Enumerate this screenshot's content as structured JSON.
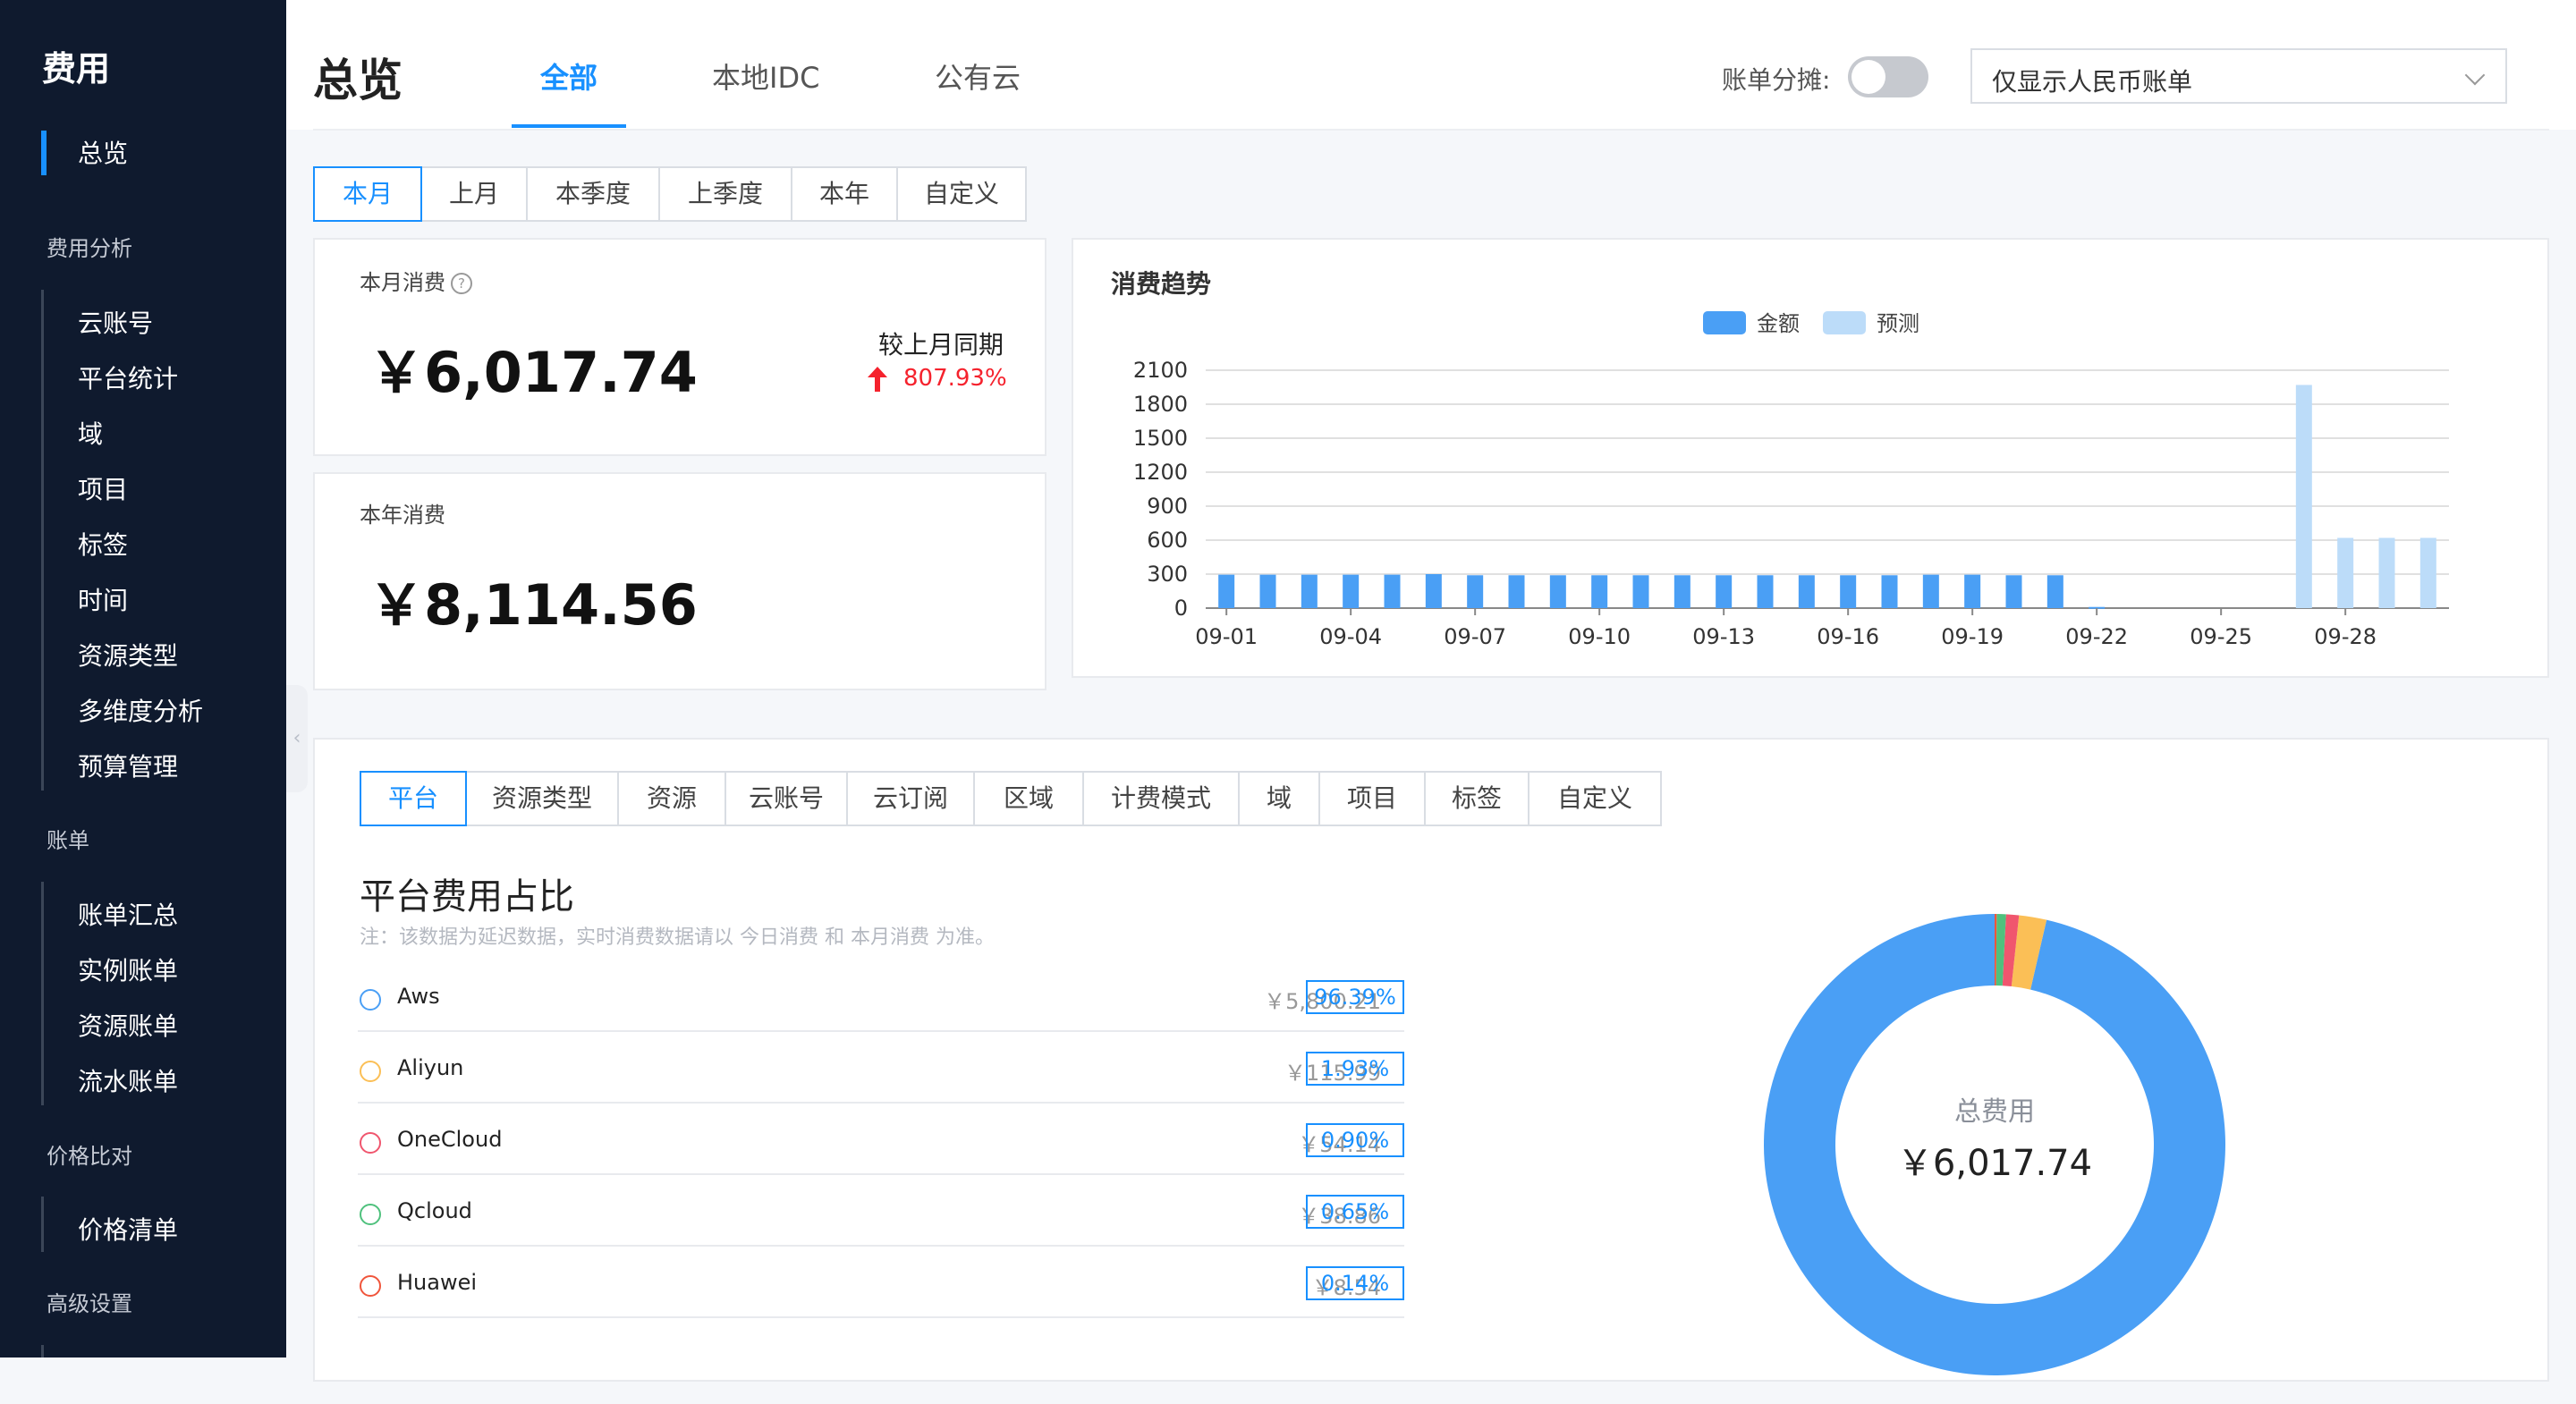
{
  "sidebar": {
    "title": "费用",
    "active_item": "总览",
    "groups": [
      {
        "label": "费用分析",
        "items": [
          "云账号",
          "平台统计",
          "域",
          "项目",
          "标签",
          "时间",
          "资源类型",
          "多维度分析",
          "预算管理"
        ]
      },
      {
        "label": "账单",
        "items": [
          "账单汇总",
          "实例账单",
          "资源账单",
          "流水账单"
        ]
      },
      {
        "label": "价格比对",
        "items": [
          "价格清单"
        ]
      },
      {
        "label": "高级设置",
        "items": []
      }
    ],
    "collapse_icon": "chevron-left-icon"
  },
  "header": {
    "title": "总览",
    "tabs": [
      "全部",
      "本地IDC",
      "公有云"
    ],
    "active_tab": "全部",
    "split_label": "账单分摊:",
    "split_enabled": false,
    "currency_select": "仅显示人民币账单"
  },
  "periods": {
    "options": [
      "本月",
      "上月",
      "本季度",
      "上季度",
      "本年",
      "自定义"
    ],
    "active": "本月"
  },
  "month_card": {
    "label": "本月消费",
    "amount": "￥6,017.74",
    "compare_label": "较上月同期",
    "compare_value": "807.93%",
    "trend": "up",
    "trend_color": "#f5222d"
  },
  "year_card": {
    "label": "本年消费",
    "amount": "￥8,114.56"
  },
  "chart_data": {
    "type": "bar",
    "title": "消费趋势",
    "legend": [
      "金额",
      "预测"
    ],
    "legend_position": "top-center",
    "grid": true,
    "colors": {
      "金额": "#4a9ff5",
      "预测": "#bcdcf9"
    },
    "x": [
      "09-01",
      "09-02",
      "09-03",
      "09-04",
      "09-05",
      "09-06",
      "09-07",
      "09-08",
      "09-09",
      "09-10",
      "09-11",
      "09-12",
      "09-13",
      "09-14",
      "09-15",
      "09-16",
      "09-17",
      "09-18",
      "09-19",
      "09-20",
      "09-21",
      "09-22",
      "09-23",
      "09-24",
      "09-25",
      "09-26",
      "09-27",
      "09-28",
      "09-29",
      "09-30"
    ],
    "x_tick_labels": [
      "09-01",
      "09-04",
      "09-07",
      "09-10",
      "09-13",
      "09-16",
      "09-19",
      "09-22",
      "09-25",
      "09-28"
    ],
    "y_ticks": [
      0,
      300,
      600,
      900,
      1200,
      1500,
      1800,
      2100
    ],
    "ylim": [
      0,
      2100
    ],
    "series": [
      {
        "name": "金额",
        "values": [
          295,
          295,
          295,
          295,
          295,
          300,
          290,
          290,
          290,
          290,
          290,
          290,
          290,
          290,
          290,
          290,
          290,
          295,
          295,
          290,
          290,
          10,
          0,
          0,
          0,
          0,
          0,
          0,
          0,
          0
        ]
      },
      {
        "name": "预测",
        "values": [
          0,
          0,
          0,
          0,
          0,
          0,
          0,
          0,
          0,
          0,
          0,
          0,
          0,
          0,
          0,
          0,
          0,
          0,
          0,
          0,
          0,
          0,
          0,
          0,
          0,
          0,
          1970,
          620,
          620,
          620
        ]
      }
    ]
  },
  "dimension_tabs": {
    "options": [
      "平台",
      "资源类型",
      "资源",
      "云账号",
      "云订阅",
      "区域",
      "计费模式",
      "域",
      "项目",
      "标签",
      "自定义"
    ],
    "active": "平台"
  },
  "breakdown": {
    "title": "平台费用占比",
    "note": "注：该数据为延迟数据，实时消费数据请以 今日消费 和 本月消费 为准。",
    "rows": [
      {
        "name": "Aws",
        "amount": "￥5,800.21",
        "pct": "96.39%",
        "color": "#4a9ff5",
        "value": 5800.21
      },
      {
        "name": "Aliyun",
        "amount": "￥115.99",
        "pct": "1.93%",
        "color": "#fbbf56",
        "value": 115.99
      },
      {
        "name": "OneCloud",
        "amount": "￥54.14",
        "pct": "0.90%",
        "color": "#f0566e",
        "value": 54.14
      },
      {
        "name": "Qcloud",
        "amount": "￥38.86",
        "pct": "0.65%",
        "color": "#4fc17d",
        "value": 38.86
      },
      {
        "name": "Huawei",
        "amount": "￥8.54",
        "pct": "0.14%",
        "color": "#f0553b",
        "value": 8.54
      }
    ],
    "donut_label": "总费用",
    "donut_total": "￥6,017.74"
  }
}
